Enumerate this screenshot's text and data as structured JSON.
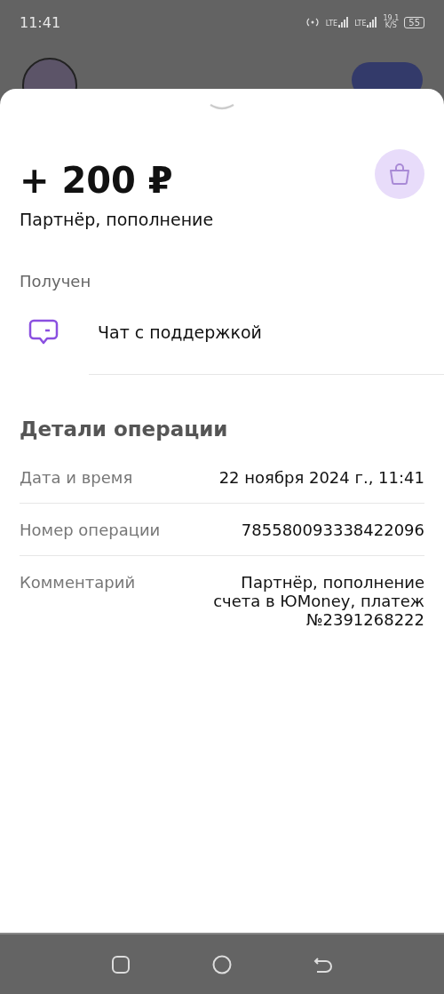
{
  "status_bar": {
    "time": "11:41",
    "networks": [
      "LTE",
      "LTE"
    ],
    "speed": "19,1",
    "speed_unit": "K/S",
    "battery": "55"
  },
  "operation": {
    "amount": "+ 200 ₽",
    "title": "Партнёр, пополнение",
    "status": "Получен"
  },
  "actions": [
    {
      "label": "Чат с поддержкой"
    }
  ],
  "details": {
    "heading": "Детали операции",
    "rows": [
      {
        "label": "Дата и время",
        "value": "22 ноября 2024 г., 11:41"
      },
      {
        "label": "Номер операции",
        "value": "785580093338422096"
      },
      {
        "label": "Комментарий",
        "value": "Партнёр, пополнение счета в ЮMoney, платеж №2391268222"
      }
    ]
  },
  "nav_bar": {
    "buttons": [
      {
        "kind": "recents"
      },
      {
        "kind": "home"
      },
      {
        "kind": "back"
      }
    ]
  }
}
